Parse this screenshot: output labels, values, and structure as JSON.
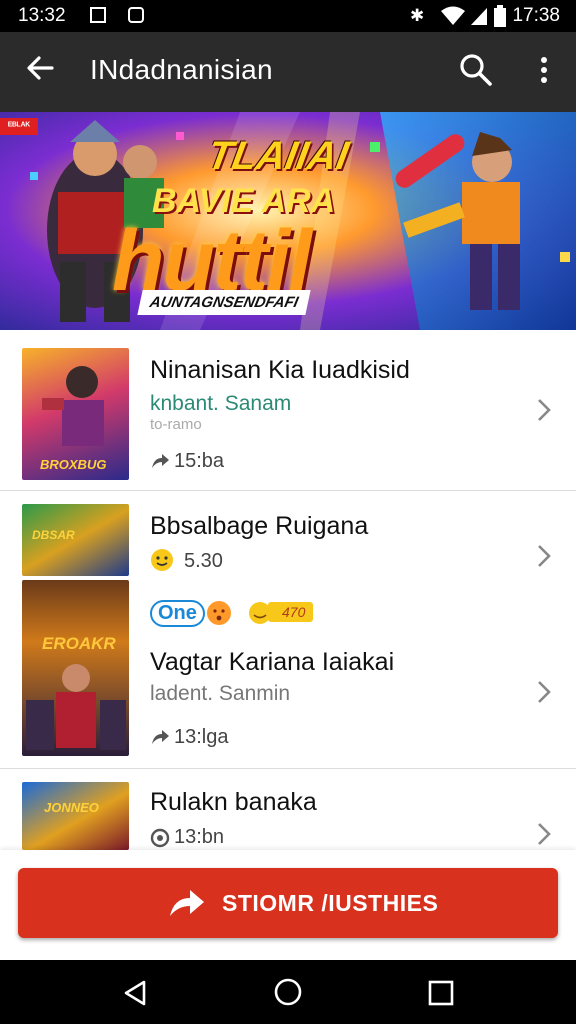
{
  "status_bar": {
    "time_left": "13:32",
    "time_right": "17:38"
  },
  "app_bar": {
    "title": "INdadnanisian"
  },
  "banner": {
    "tag": "ᴱᴮᴸᴬᴷ",
    "title_line1": "TLAIIAI",
    "title_line2": "BAVIE ARA",
    "title_line3": "huttil",
    "subtitle": "AUNTAGNSENDFAFI"
  },
  "items": [
    {
      "title": "Ninanisan Kia Iuadkisid",
      "subtitle": "knbant. Sanam",
      "small": "to-ramo",
      "meta": "15:ba",
      "thumb_caption": "BROXBUG"
    },
    {
      "title": "Bbsalbage Ruigana",
      "meta": "5.30",
      "thumb_caption": "DBSAR"
    },
    {
      "badge_left": "One",
      "badge_right": "470"
    },
    {
      "title": "Vagtar Kariana Iaiakai",
      "subtitle": "ladent. Sanmin",
      "meta": "13:lga",
      "thumb_caption": "EROAKR"
    },
    {
      "title": "Rulakn banaka",
      "meta": "13:bn",
      "thumb_caption": "JONNEO"
    }
  ],
  "cta": {
    "label": "STIOMR /IUSTHIES"
  },
  "colors": {
    "accent": "#d8321f",
    "app_bar": "#2b2b2b",
    "teal_text": "#2b8a74"
  },
  "icons": [
    "back-arrow-icon",
    "search-icon",
    "more-vert-icon",
    "close-icon",
    "chevron-right-icon",
    "comment-icon",
    "share-arrow-icon",
    "nav-back-icon",
    "nav-home-icon",
    "nav-recents-icon"
  ]
}
